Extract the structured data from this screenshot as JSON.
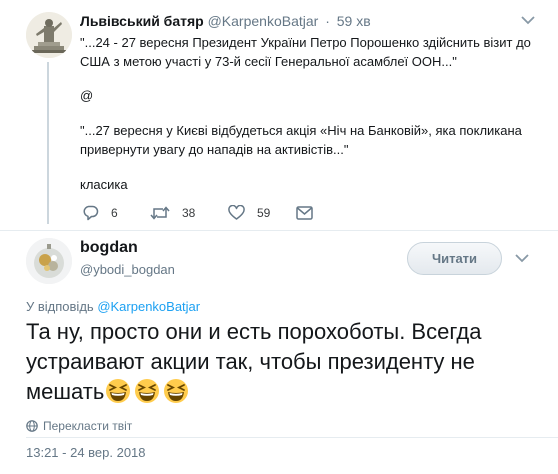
{
  "parent_tweet": {
    "author_name": "Львівський батяр",
    "author_handle": "@KarpenkoBatjar",
    "separator": "·",
    "time_ago": "59 хв",
    "paragraphs": [
      "\"...24 - 27 вересня Президент України Петро Порошенко здійснить візит до США з метою участі у 73-й сесії Генеральної асамблеї ООН...\"",
      "@",
      "\"...27 вересня у Києві відбудеться акція «Ніч на Банковій», яка покликана привернути увагу до нападів на активістів...\"",
      "класика"
    ],
    "actions": {
      "replies": "6",
      "retweets": "38",
      "likes": "59"
    }
  },
  "main_tweet": {
    "author_name": "bogdan",
    "author_handle": "@ybodi_bogdan",
    "follow_label": "Читати",
    "reply_to_prefix": "У відповідь",
    "reply_to_handle": "@KarpenkoBatjar",
    "text": "Та ну, просто они и есть порохоботы. Всегда устраивают акции так, чтобы президенту не мешать",
    "emoji_count": 3,
    "translate_label": "Перекласти твіт",
    "timestamp": "13:21 - 24 вер. 2018"
  },
  "icons": {
    "reply": "reply-icon",
    "retweet": "retweet-icon",
    "like": "heart-icon",
    "dm": "envelope-icon",
    "caret": "chevron-down-icon",
    "globe": "globe-icon",
    "emoji": "grinning-squinting-face-emoji"
  },
  "colors": {
    "link": "#1da1f2",
    "muted": "#657786",
    "text": "#14171a",
    "divider": "#e6ecf0"
  }
}
